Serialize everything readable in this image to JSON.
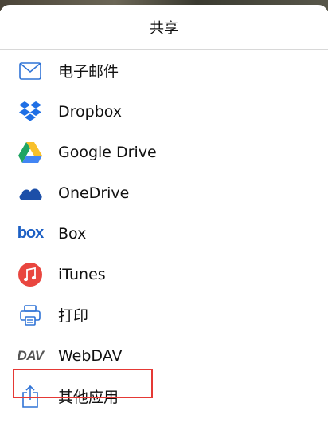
{
  "sheet": {
    "title": "共享"
  },
  "items": [
    {
      "label": "电子邮件",
      "icon": "mail-icon"
    },
    {
      "label": "Dropbox",
      "icon": "dropbox-icon"
    },
    {
      "label": "Google Drive",
      "icon": "google-drive-icon"
    },
    {
      "label": "OneDrive",
      "icon": "onedrive-icon"
    },
    {
      "label": "Box",
      "icon": "box-icon",
      "icon_text": "box"
    },
    {
      "label": "iTunes",
      "icon": "itunes-icon"
    },
    {
      "label": "打印",
      "icon": "printer-icon"
    },
    {
      "label": "WebDAV",
      "icon": "webdav-icon",
      "icon_text": "DAV"
    },
    {
      "label": "其他应用",
      "icon": "share-icon"
    }
  ],
  "colors": {
    "accent_blue": "#2f73d6",
    "highlight_red": "#e53935",
    "itunes_red": "#e9463f"
  }
}
